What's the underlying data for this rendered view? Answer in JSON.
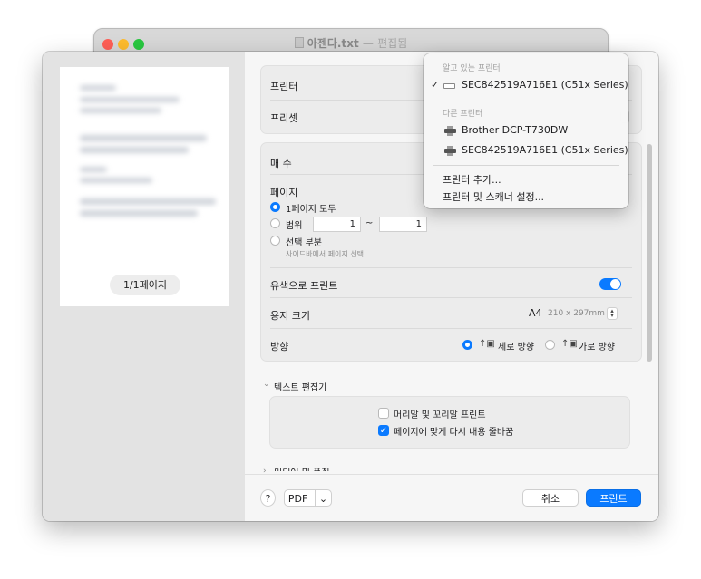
{
  "window": {
    "title": "아젠다.txt",
    "title_sep": "—",
    "title_status": "편집됨"
  },
  "preview": {
    "page_indicator": "1/1페이지"
  },
  "printer_section": {
    "printer_label": "프린터",
    "preset_label": "프리셋"
  },
  "copies": {
    "label": "매 수"
  },
  "pages": {
    "label": "페이지",
    "all_pages": "1페이지 모두",
    "range_label": "범위",
    "range_from": "1",
    "range_sep": "~",
    "range_to": "1",
    "selection_label": "선택 부분",
    "selection_hint": "사이드바에서 페이지 선택"
  },
  "color": {
    "label": "유색으로 프린트",
    "enabled": true
  },
  "paper": {
    "label": "용지 크기",
    "value": "A4",
    "dimensions": "210 x 297mm"
  },
  "orientation": {
    "label": "방향",
    "portrait": "세로 방향",
    "landscape": "가로 방향"
  },
  "text_editor": {
    "section_label": "텍스트 편집기",
    "header_footer": "머리말 및 꼬리말 프린트",
    "header_footer_checked": false,
    "rewrap": "페이지에 맞게 다시 내용 줄바꿈",
    "rewrap_checked": true
  },
  "media_section": {
    "label": "미디어 및 품질"
  },
  "footer": {
    "help": "?",
    "pdf": "PDF",
    "pdf_arrow": "⌄",
    "cancel": "취소",
    "print": "프린트"
  },
  "printer_menu": {
    "known_header": "알고 있는 프린터",
    "known": [
      {
        "name": "SEC842519A716E1 (C51x Series)",
        "checked": true,
        "check": "✓"
      }
    ],
    "other_header": "다른 프린터",
    "others": [
      {
        "name": "Brother DCP-T730DW"
      },
      {
        "name": "SEC842519A716E1 (C51x Series)"
      }
    ],
    "add_printer": "프린터 추가...",
    "settings": "프린터 및 스캐너 설정..."
  },
  "colors": {
    "accent": "#0a7aff",
    "close": "#ff5f57",
    "minimize": "#febc2e",
    "zoom": "#28c840"
  }
}
